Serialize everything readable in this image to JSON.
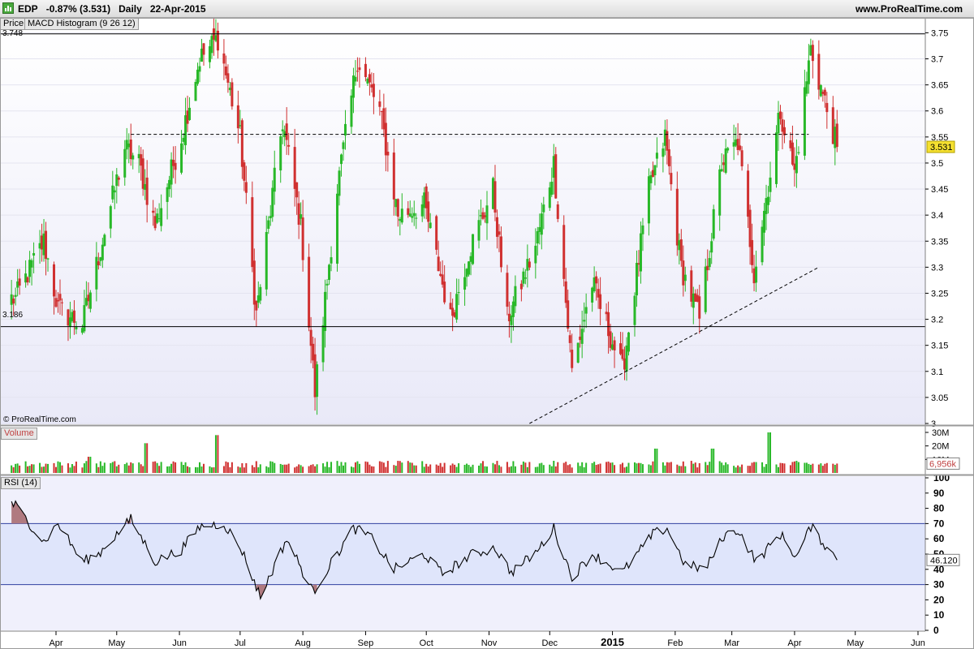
{
  "header": {
    "symbol": "EDP",
    "change": "-0.87% (3.531)",
    "period": "Daily",
    "date": "22-Apr-2015",
    "website": "www.ProRealTime.com"
  },
  "price_panel": {
    "tab_price": "Price",
    "tab_indicator": "MACD Histogram (9 26 12)",
    "resistance_label": "3.748",
    "support_label": "3.186",
    "last_price_label": "3.531",
    "copyright": "© ProRealTime.com",
    "y_ticks": [
      "3.75",
      "3.7",
      "3.65",
      "3.6",
      "3.55",
      "3.5",
      "3.45",
      "3.4",
      "3.35",
      "3.3",
      "3.25",
      "3.2",
      "3.15",
      "3.1",
      "3.05",
      "3"
    ]
  },
  "volume_panel": {
    "title": "Volume",
    "y_ticks": [
      "30M",
      "20M",
      "10M"
    ],
    "last_value_label": "6,956k"
  },
  "rsi_panel": {
    "title": "RSI (14)",
    "y_ticks": [
      "100",
      "90",
      "80",
      "70",
      "60",
      "50",
      "40",
      "30",
      "20",
      "10",
      "0"
    ],
    "last_value_label": "46.120"
  },
  "x_axis": {
    "labels": [
      "Apr",
      "May",
      "Jun",
      "Jul",
      "Aug",
      "Sep",
      "Oct",
      "Nov",
      "Dec",
      "2015",
      "Feb",
      "Mar",
      "Apr",
      "May",
      "Jun"
    ]
  },
  "colors": {
    "up": "#28b828",
    "down": "#d03030",
    "panel_bg": "#f1f1fd",
    "rsi_band": "#dfe5fb",
    "axis_highlight": "#f5e030"
  },
  "chart_data": {
    "type": "candlestick",
    "interval": "daily",
    "x_range": [
      "2014-03",
      "2015-06"
    ],
    "key_levels": {
      "resistance": 3.748,
      "dashed_level": 3.555,
      "support": 3.186
    },
    "trendline": [
      {
        "date": "2014-11-21",
        "value": 3.0
      },
      {
        "date": "2015-04-13",
        "value": 3.3
      }
    ],
    "close_anchors": [
      {
        "date": "2014-03-12",
        "close": 3.24
      },
      {
        "date": "2014-03-26",
        "close": 3.35
      },
      {
        "date": "2014-04-02",
        "close": 3.22
      },
      {
        "date": "2014-04-14",
        "close": 3.19
      },
      {
        "date": "2014-04-22",
        "close": 3.32
      },
      {
        "date": "2014-05-05",
        "close": 3.53
      },
      {
        "date": "2014-05-12",
        "close": 3.5
      },
      {
        "date": "2014-05-20",
        "close": 3.38
      },
      {
        "date": "2014-06-02",
        "close": 3.55
      },
      {
        "date": "2014-06-11",
        "close": 3.7
      },
      {
        "date": "2014-06-20",
        "close": 3.74
      },
      {
        "date": "2014-07-01",
        "close": 3.55
      },
      {
        "date": "2014-07-09",
        "close": 3.21
      },
      {
        "date": "2014-07-22",
        "close": 3.58
      },
      {
        "date": "2014-07-31",
        "close": 3.38
      },
      {
        "date": "2014-08-07",
        "close": 3.06
      },
      {
        "date": "2014-08-18",
        "close": 3.45
      },
      {
        "date": "2014-08-28",
        "close": 3.7
      },
      {
        "date": "2014-09-08",
        "close": 3.6
      },
      {
        "date": "2014-09-17",
        "close": 3.4
      },
      {
        "date": "2014-09-30",
        "close": 3.42
      },
      {
        "date": "2014-10-13",
        "close": 3.2
      },
      {
        "date": "2014-10-22",
        "close": 3.33
      },
      {
        "date": "2014-11-03",
        "close": 3.45
      },
      {
        "date": "2014-11-10",
        "close": 3.2
      },
      {
        "date": "2014-11-24",
        "close": 3.34
      },
      {
        "date": "2014-12-03",
        "close": 3.5
      },
      {
        "date": "2014-12-12",
        "close": 3.1
      },
      {
        "date": "2014-12-22",
        "close": 3.27
      },
      {
        "date": "2015-01-06",
        "close": 3.1
      },
      {
        "date": "2015-01-19",
        "close": 3.45
      },
      {
        "date": "2015-01-27",
        "close": 3.55
      },
      {
        "date": "2015-02-04",
        "close": 3.3
      },
      {
        "date": "2015-02-13",
        "close": 3.2
      },
      {
        "date": "2015-02-24",
        "close": 3.5
      },
      {
        "date": "2015-03-04",
        "close": 3.54
      },
      {
        "date": "2015-03-12",
        "close": 3.29
      },
      {
        "date": "2015-03-25",
        "close": 3.6
      },
      {
        "date": "2015-04-01",
        "close": 3.48
      },
      {
        "date": "2015-04-09",
        "close": 3.72
      },
      {
        "date": "2015-04-15",
        "close": 3.63
      },
      {
        "date": "2015-04-22",
        "close": 3.531
      }
    ],
    "volume_spikes_millions": [
      {
        "date": "2014-04-18",
        "volume": 12
      },
      {
        "date": "2014-05-16",
        "volume": 22
      },
      {
        "date": "2014-06-20",
        "volume": 28
      },
      {
        "date": "2015-01-23",
        "volume": 18
      },
      {
        "date": "2015-02-20",
        "volume": 18
      },
      {
        "date": "2015-03-20",
        "volume": 30
      }
    ],
    "rsi_levels": {
      "upper": 70,
      "lower": 30
    },
    "rsi_anchors": [
      {
        "date": "2014-03-12",
        "value": 82
      },
      {
        "date": "2014-03-26",
        "value": 58
      },
      {
        "date": "2014-04-02",
        "value": 70
      },
      {
        "date": "2014-04-14",
        "value": 45
      },
      {
        "date": "2014-04-22",
        "value": 50
      },
      {
        "date": "2014-05-08",
        "value": 73
      },
      {
        "date": "2014-05-20",
        "value": 45
      },
      {
        "date": "2014-06-02",
        "value": 53
      },
      {
        "date": "2014-06-11",
        "value": 68
      },
      {
        "date": "2014-06-23",
        "value": 70
      },
      {
        "date": "2014-07-02",
        "value": 52
      },
      {
        "date": "2014-07-11",
        "value": 22
      },
      {
        "date": "2014-07-24",
        "value": 60
      },
      {
        "date": "2014-08-06",
        "value": 25
      },
      {
        "date": "2014-08-26",
        "value": 67
      },
      {
        "date": "2014-09-03",
        "value": 62
      },
      {
        "date": "2014-09-15",
        "value": 40
      },
      {
        "date": "2014-09-30",
        "value": 50
      },
      {
        "date": "2014-10-09",
        "value": 37
      },
      {
        "date": "2014-10-24",
        "value": 50
      },
      {
        "date": "2014-11-04",
        "value": 54
      },
      {
        "date": "2014-11-12",
        "value": 38
      },
      {
        "date": "2014-11-25",
        "value": 52
      },
      {
        "date": "2014-12-03",
        "value": 67
      },
      {
        "date": "2014-12-12",
        "value": 35
      },
      {
        "date": "2014-12-22",
        "value": 50
      },
      {
        "date": "2015-01-06",
        "value": 38
      },
      {
        "date": "2015-01-21",
        "value": 63
      },
      {
        "date": "2015-01-28",
        "value": 67
      },
      {
        "date": "2015-02-06",
        "value": 43
      },
      {
        "date": "2015-02-16",
        "value": 40
      },
      {
        "date": "2015-02-25",
        "value": 62
      },
      {
        "date": "2015-03-04",
        "value": 66
      },
      {
        "date": "2015-03-13",
        "value": 45
      },
      {
        "date": "2015-03-25",
        "value": 63
      },
      {
        "date": "2015-04-02",
        "value": 48
      },
      {
        "date": "2015-04-09",
        "value": 68
      },
      {
        "date": "2015-04-22",
        "value": 46.12
      }
    ]
  }
}
